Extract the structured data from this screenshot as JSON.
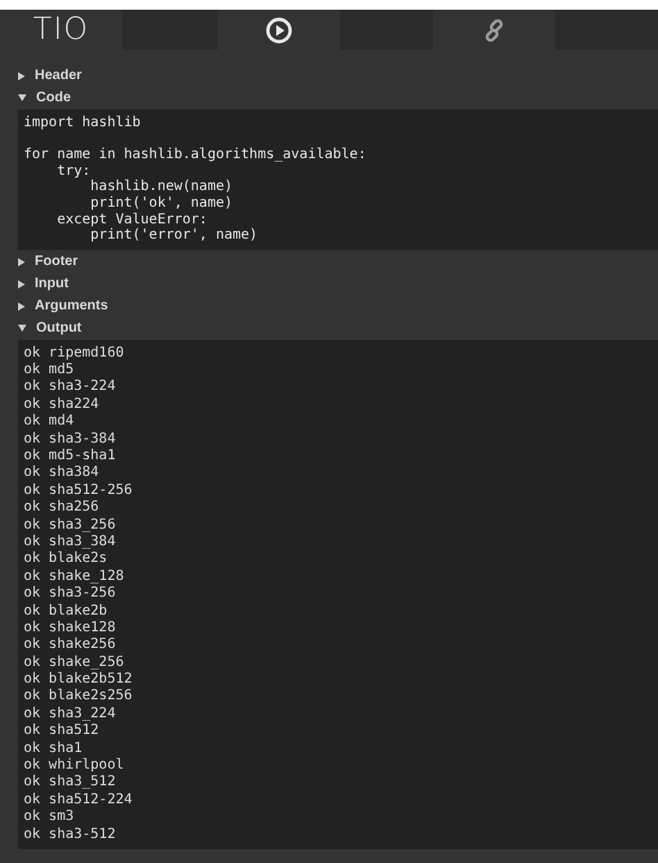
{
  "toolbar": {
    "logo": "TIO"
  },
  "sections": [
    {
      "title": "Header",
      "expanded": false
    },
    {
      "title": "Code",
      "expanded": true,
      "kind": "code",
      "text": "import hashlib\n\nfor name in hashlib.algorithms_available:\n    try:\n        hashlib.new(name)\n        print('ok', name)\n    except ValueError:\n        print('error', name)"
    },
    {
      "title": "Footer",
      "expanded": false
    },
    {
      "title": "Input",
      "expanded": false
    },
    {
      "title": "Arguments",
      "expanded": false
    },
    {
      "title": "Output",
      "expanded": true,
      "kind": "output",
      "lines": [
        "ok ripemd160",
        "ok md5",
        "ok sha3-224",
        "ok sha224",
        "ok md4",
        "ok sha3-384",
        "ok md5-sha1",
        "ok sha384",
        "ok sha512-256",
        "ok sha256",
        "ok sha3_256",
        "ok sha3_384",
        "ok blake2s",
        "ok shake_128",
        "ok sha3-256",
        "ok blake2b",
        "ok shake128",
        "ok shake256",
        "ok shake_256",
        "ok blake2b512",
        "ok blake2s256",
        "ok sha3_224",
        "ok sha512",
        "ok sha1",
        "ok whirlpool",
        "ok sha3_512",
        "ok sha512-224",
        "ok sm3",
        "ok sha3-512"
      ]
    }
  ]
}
